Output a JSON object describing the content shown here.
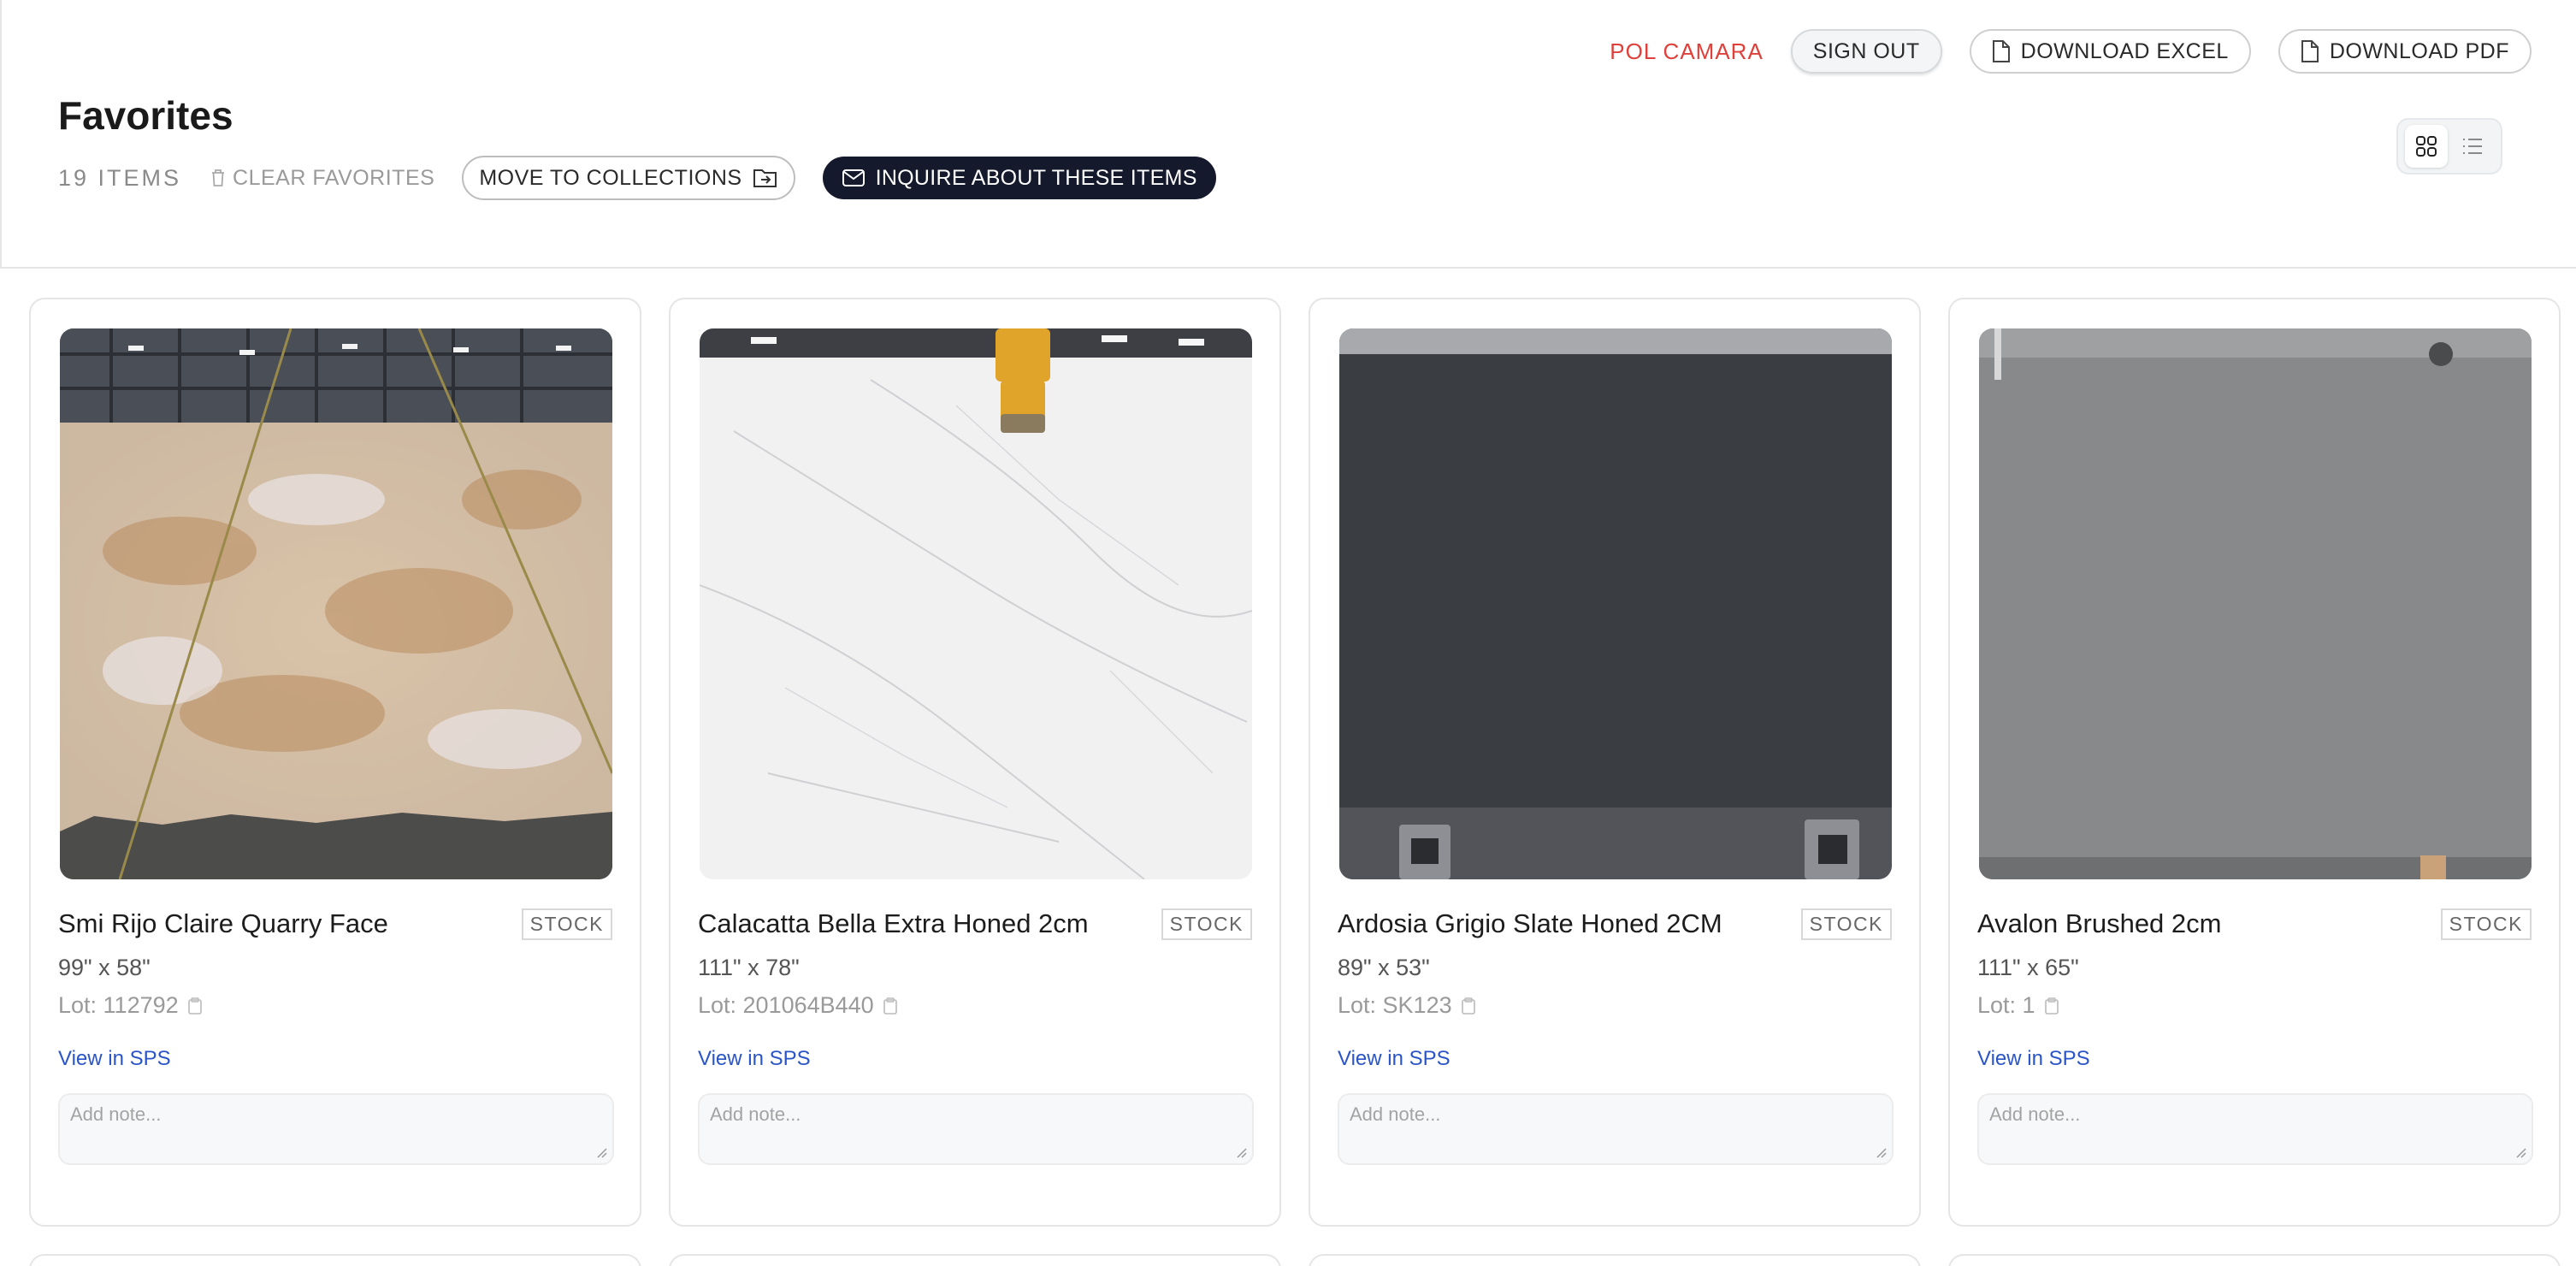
{
  "header": {
    "user_name": "POL CAMARA",
    "sign_out": "SIGN OUT",
    "download_excel": "DOWNLOAD EXCEL",
    "download_pdf": "DOWNLOAD PDF",
    "title": "Favorites",
    "items_count": "19 ITEMS",
    "clear_favorites": "CLEAR FAVORITES",
    "move_to_collections": "MOVE TO COLLECTIONS",
    "inquire": "INQUIRE ABOUT THESE ITEMS",
    "view_mode": "grid"
  },
  "colors": {
    "accent_red": "#e0403a",
    "primary_dark": "#14192c",
    "link_blue": "#2a55c8"
  },
  "cards": [
    {
      "title": "Smi Rijo Claire Quarry Face",
      "badge": "STOCK",
      "dims": "99\" x 58\"",
      "lot": "Lot: 112792",
      "link": "View in SPS",
      "note_placeholder": "Add note..."
    },
    {
      "title": "Calacatta Bella Extra Honed 2cm",
      "badge": "STOCK",
      "dims": "111\" x 78\"",
      "lot": "Lot: 201064B440",
      "link": "View in SPS",
      "note_placeholder": "Add note..."
    },
    {
      "title": "Ardosia Grigio Slate Honed 2CM",
      "badge": "STOCK",
      "dims": "89\" x 53\"",
      "lot": "Lot: SK123",
      "link": "View in SPS",
      "note_placeholder": "Add note..."
    },
    {
      "title": "Avalon Brushed 2cm",
      "badge": "STOCK",
      "dims": "111\" x 65\"",
      "lot": "Lot: 1",
      "link": "View in SPS",
      "note_placeholder": "Add note..."
    }
  ]
}
